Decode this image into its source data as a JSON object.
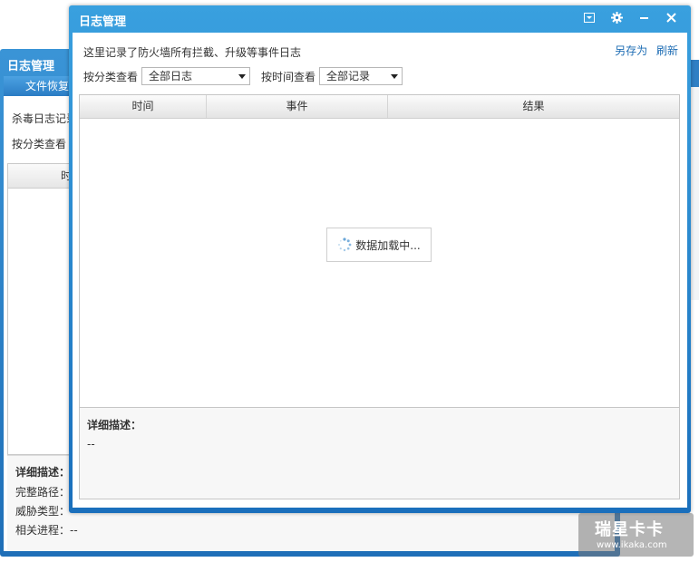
{
  "back_window": {
    "title": "日志管理",
    "tab_label": "文件恢复",
    "row1_text": "杀毒日志记录",
    "row2_text": "按分类查看",
    "table_header": "时",
    "desc_label": "详细描述：",
    "path_label": "完整路径：",
    "threat_label": "威胁类型：",
    "process_label": "相关进程：--"
  },
  "window": {
    "title": "日志管理",
    "controls": {
      "menu_icon": "dropdown-menu-icon",
      "settings_icon": "gear-icon",
      "minimize_icon": "minimize-icon",
      "close_icon": "close-icon"
    }
  },
  "intro_text": "这里记录了防火墙所有拦截、升级等事件日志",
  "actions": {
    "save_as": "另存为",
    "refresh": "刷新"
  },
  "filters": {
    "category_label": "按分类查看",
    "category_value": "全部日志",
    "time_label": "按时间查看",
    "time_value": "全部记录"
  },
  "table": {
    "columns": [
      "时间",
      "事件",
      "结果"
    ],
    "loading_text": "数据加载中..."
  },
  "detail": {
    "label": "详细描述：",
    "value": "--"
  },
  "watermark": {
    "brand": "瑞星卡卡",
    "url": "www.ikaka.com"
  },
  "colors": {
    "title_bar": "#2a86cf",
    "link": "#1e6db4"
  }
}
